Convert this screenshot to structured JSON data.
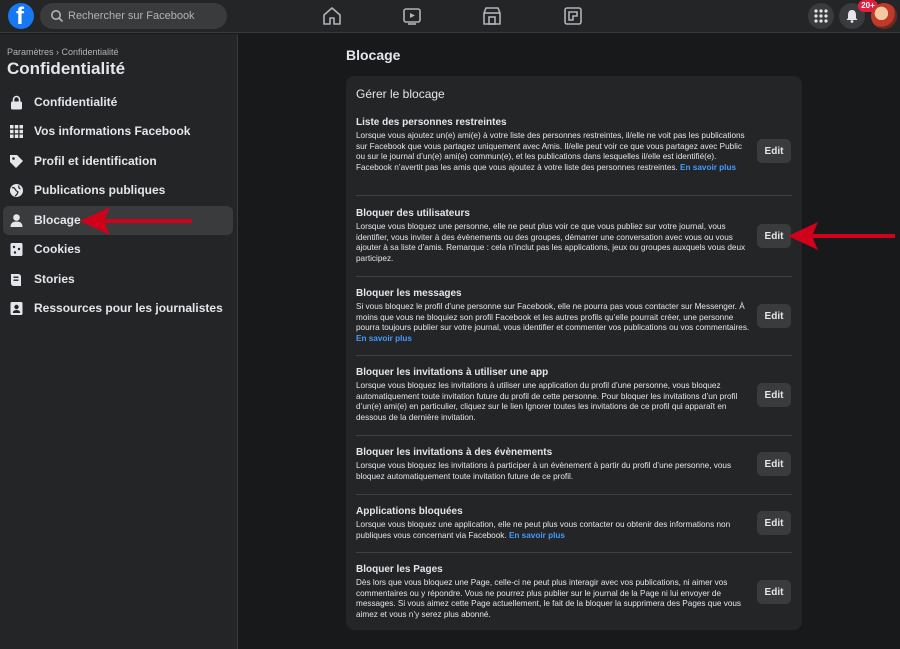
{
  "topbar": {
    "logo": "f",
    "search_placeholder": "Rechercher sur Facebook",
    "nav_icons": [
      "home-icon",
      "watch-icon",
      "marketplace-icon",
      "gaming-icon"
    ],
    "notifications_badge": "20+"
  },
  "sidebar": {
    "breadcrumb": "Paramètres › Confidentialité",
    "title": "Confidentialité",
    "items": [
      {
        "label": "Confidentialité",
        "icon": "lock-icon"
      },
      {
        "label": "Vos informations Facebook",
        "icon": "grid-icon"
      },
      {
        "label": "Profil et identification",
        "icon": "tag-icon"
      },
      {
        "label": "Publications publiques",
        "icon": "globe-icon"
      },
      {
        "label": "Blocage",
        "icon": "person-icon"
      },
      {
        "label": "Cookies",
        "icon": "cookie-icon"
      },
      {
        "label": "Stories",
        "icon": "book-icon"
      },
      {
        "label": "Ressources pour les journalistes",
        "icon": "id-card-icon"
      }
    ],
    "active_item": "Blocage"
  },
  "main": {
    "title": "Blocage",
    "card_title": "Gérer le blocage",
    "edit_label": "Edit",
    "more_label": "En savoir plus",
    "sections": [
      {
        "heading": "Liste des personnes restreintes",
        "text": "Lorsque vous ajoutez un(e) ami(e) à votre liste des personnes restreintes, il/elle ne voit pas les publications sur Facebook que vous partagez uniquement avec Amis. Il/elle peut voir ce que vous partagez avec Public ou sur le journal d’un(e) ami(e) commun(e), et les publications dans lesquelles il/elle est identifié(e). Facebook n’avertit pas les amis que vous ajoutez à votre liste des personnes restreintes."
      },
      {
        "heading": "Bloquer des utilisateurs",
        "text": "Lorsque vous bloquez une personne, elle ne peut plus voir ce que vous publiez sur votre journal, vous identifier, vous inviter à des évènements ou des groupes, démarrer une conversation avec vous ou vous ajouter à sa liste d’amis. Remarque : cela n’inclut pas les applications, jeux ou groupes auxquels vous deux participez."
      },
      {
        "heading": "Bloquer les messages",
        "text": "Si vous bloquez le profil d’une personne sur Facebook, elle ne pourra pas vous contacter sur Messenger. À moins que vous ne bloquiez son profil Facebook et les autres profils qu’elle pourrait créer, une personne pourra toujours publier sur votre journal, vous identifier et commenter vos publications ou vos commentaires."
      },
      {
        "heading": "Bloquer les invitations à utiliser une app",
        "text": "Lorsque vous bloquez les invitations à utiliser une application du profil d’une personne, vous bloquez automatiquement toute invitation future du profil de cette personne. Pour bloquer les invitations d’un profil d’un(e) ami(e) en particulier, cliquez sur le lien Ignorer toutes les invitations de ce profil qui apparaît en dessous de la dernière invitation."
      },
      {
        "heading": "Bloquer les invitations à des évènements",
        "text": "Lorsque vous bloquez les invitations à participer à un évènement à partir du profil d’une personne, vous bloquez automatiquement toute invitation future de ce profil."
      },
      {
        "heading": "Applications bloquées",
        "text": "Lorsque vous bloquez une application, elle ne peut plus vous contacter ou obtenir des informations non publiques vous concernant via Facebook."
      },
      {
        "heading": "Bloquer les Pages",
        "text": "Dès lors que vous bloquez une Page, celle-ci ne peut plus interagir avec vos publications, ni aimer vos commentaires ou y répondre. Vous ne pourrez plus publier sur le journal de la Page ni lui envoyer de messages. Si vous aimez cette Page actuellement, le fait de la bloquer la supprimera des Pages que vous aimez et vous n’y serez plus abonné."
      }
    ]
  },
  "colors": {
    "background": "#18191a",
    "surface": "#242526",
    "brand": "#1877f2",
    "link": "#4599ff",
    "annotation_arrow": "#d0021b"
  }
}
